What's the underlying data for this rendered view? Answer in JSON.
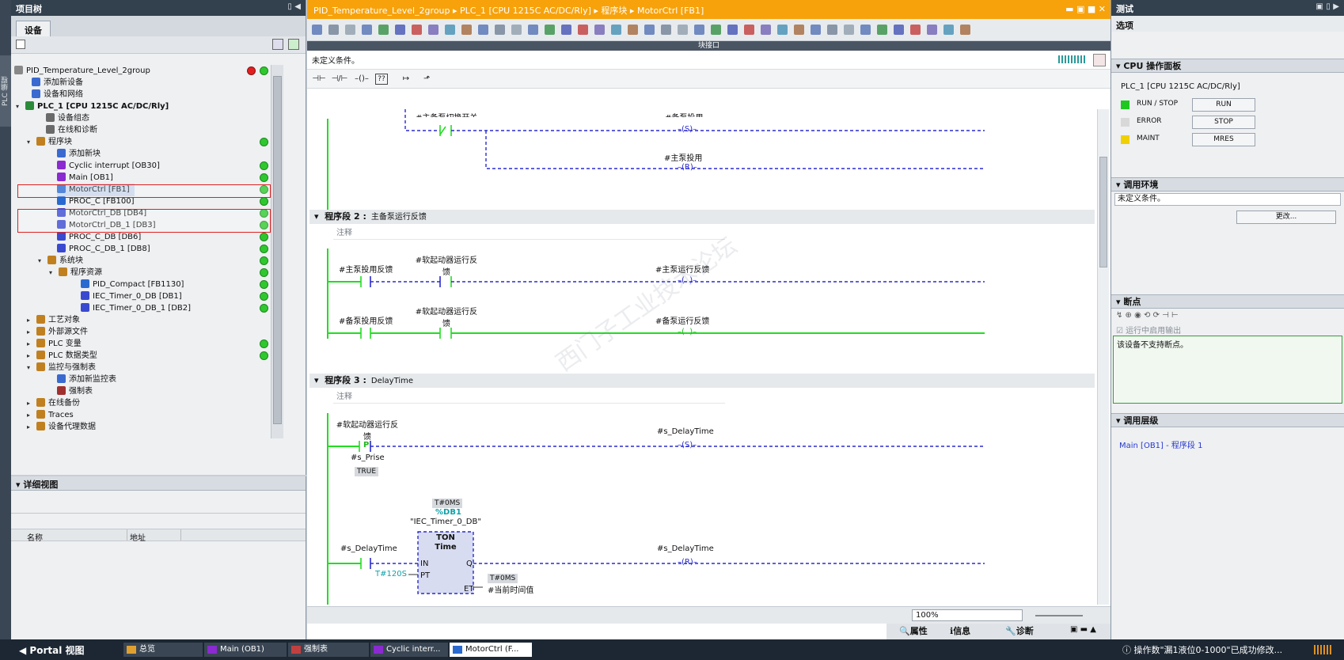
{
  "sidebar": {
    "label": "PLC 编程"
  },
  "tree": {
    "title": "项目树",
    "tab": "设备",
    "items": [
      {
        "label": "PID_Temperature_Level_2group"
      },
      {
        "label": "添加新设备"
      },
      {
        "label": "设备和网络"
      },
      {
        "label": "PLC_1 [CPU 1215C AC/DC/Rly]"
      },
      {
        "label": "设备组态"
      },
      {
        "label": "在线和诊断"
      },
      {
        "label": "程序块"
      },
      {
        "label": "添加新块"
      },
      {
        "label": "Cyclic interrupt [OB30]"
      },
      {
        "label": "Main [OB1]"
      },
      {
        "label": "MotorCtrl [FB1]"
      },
      {
        "label": "PROC_C [FB100]"
      },
      {
        "label": "MotorCtrl_DB [DB4]"
      },
      {
        "label": "MotorCtrl_DB_1 [DB3]"
      },
      {
        "label": "PROC_C_DB [DB6]"
      },
      {
        "label": "PROC_C_DB_1 [DB8]"
      },
      {
        "label": "系统块"
      },
      {
        "label": "程序资源"
      },
      {
        "label": "PID_Compact [FB1130]"
      },
      {
        "label": "IEC_Timer_0_DB [DB1]"
      },
      {
        "label": "IEC_Timer_0_DB_1 [DB2]"
      },
      {
        "label": "工艺对象"
      },
      {
        "label": "外部源文件"
      },
      {
        "label": "PLC 变量"
      },
      {
        "label": "PLC 数据类型"
      },
      {
        "label": "监控与强制表"
      },
      {
        "label": "添加新监控表"
      },
      {
        "label": "强制表"
      },
      {
        "label": "在线备份"
      },
      {
        "label": "Traces"
      },
      {
        "label": "设备代理数据"
      }
    ]
  },
  "detail": {
    "title": "详细视图",
    "col_name": "名称",
    "col_address": "地址"
  },
  "editor": {
    "breadcrumb": [
      "PID_Temperature_Level_2group",
      "PLC_1 [CPU 1215C AC/DC/Rly]",
      "程序块",
      "MotorCtrl [FB1]"
    ],
    "interface_label": "块接口",
    "condition": "未定义条件。",
    "networks": [
      {
        "prefix": "程序段 2 :",
        "title": "主备泵运行反馈",
        "comment": "注释"
      },
      {
        "prefix": "程序段 3 :",
        "title": "DelayTime",
        "comment": "注释"
      }
    ],
    "n1": {
      "contact": "#主备泵切换开关",
      "coil_s": "#备泵投用",
      "coil_r": "#主泵投用",
      "s": "S",
      "r": "R"
    },
    "n2": {
      "r1_c1": "#主泵投用反馈",
      "r1_c2a": "#软起动器运行反",
      "r1_c2b": "馈",
      "r1_coil": "#主泵运行反馈",
      "r2_c1": "#备泵投用反馈",
      "r2_c2a": "#软起动器运行反",
      "r2_c2b": "馈",
      "r2_coil": "#备泵运行反馈"
    },
    "n3": {
      "c1a": "#软起动器运行反",
      "c1b": "馈",
      "p": "P",
      "s_prise": "#s_Prise",
      "true_val": "TRUE",
      "coil1": "#s_DelayTime",
      "s": "S",
      "t0": "T#0MS",
      "db": "%DB1",
      "instance": "\"IEC_Timer_0_DB\"",
      "ton": "TON",
      "time": "Time",
      "in": "IN",
      "pt": "PT",
      "q": "Q",
      "et": "ET",
      "c2": "#s_DelayTime",
      "coil2": "#s_DelayTime",
      "r": "R",
      "pt_val": "T#120S",
      "et_val": "T#0MS",
      "et_var": "#当前时间值"
    },
    "zoom": "100%"
  },
  "prop_tabs": {
    "props": "属性",
    "info": "信息",
    "diag": "诊断"
  },
  "test": {
    "title": "测试",
    "options": "选项",
    "cpu_panel": {
      "title": "CPU 操作面板",
      "device": "PLC_1 [CPU 1215C AC/DC/Rly]",
      "leds": [
        {
          "label": "RUN / STOP",
          "color": "#1ec81e",
          "button": "RUN"
        },
        {
          "label": "ERROR",
          "color": "#d8d8d8",
          "button": "STOP"
        },
        {
          "label": "MAINT",
          "color": "#f0d000",
          "button": "MRES"
        }
      ]
    },
    "call_env": {
      "title": "调用环境",
      "value": "未定义条件。",
      "button": "更改..."
    },
    "breakpoints": {
      "title": "断点",
      "checkbox": "运行中启用输出",
      "message": "该设备不支持断点。"
    },
    "call_hierarchy": {
      "title": "调用层级",
      "link": "Main [OB1] - 程序段 1"
    }
  },
  "taskbar": {
    "portal": "Portal 视图",
    "tasks": [
      "总览",
      "Main (OB1)",
      "强制表",
      "Cyclic interr...",
      "MotorCtrl (F..."
    ],
    "message": "操作数\"漏1液位0-1000\"已成功修改..."
  },
  "colors": {
    "accent": "#f7a20b",
    "wire_green": "#22dd22",
    "wire_blue": "#2a2ad0",
    "status_green": "#2ec82e"
  }
}
